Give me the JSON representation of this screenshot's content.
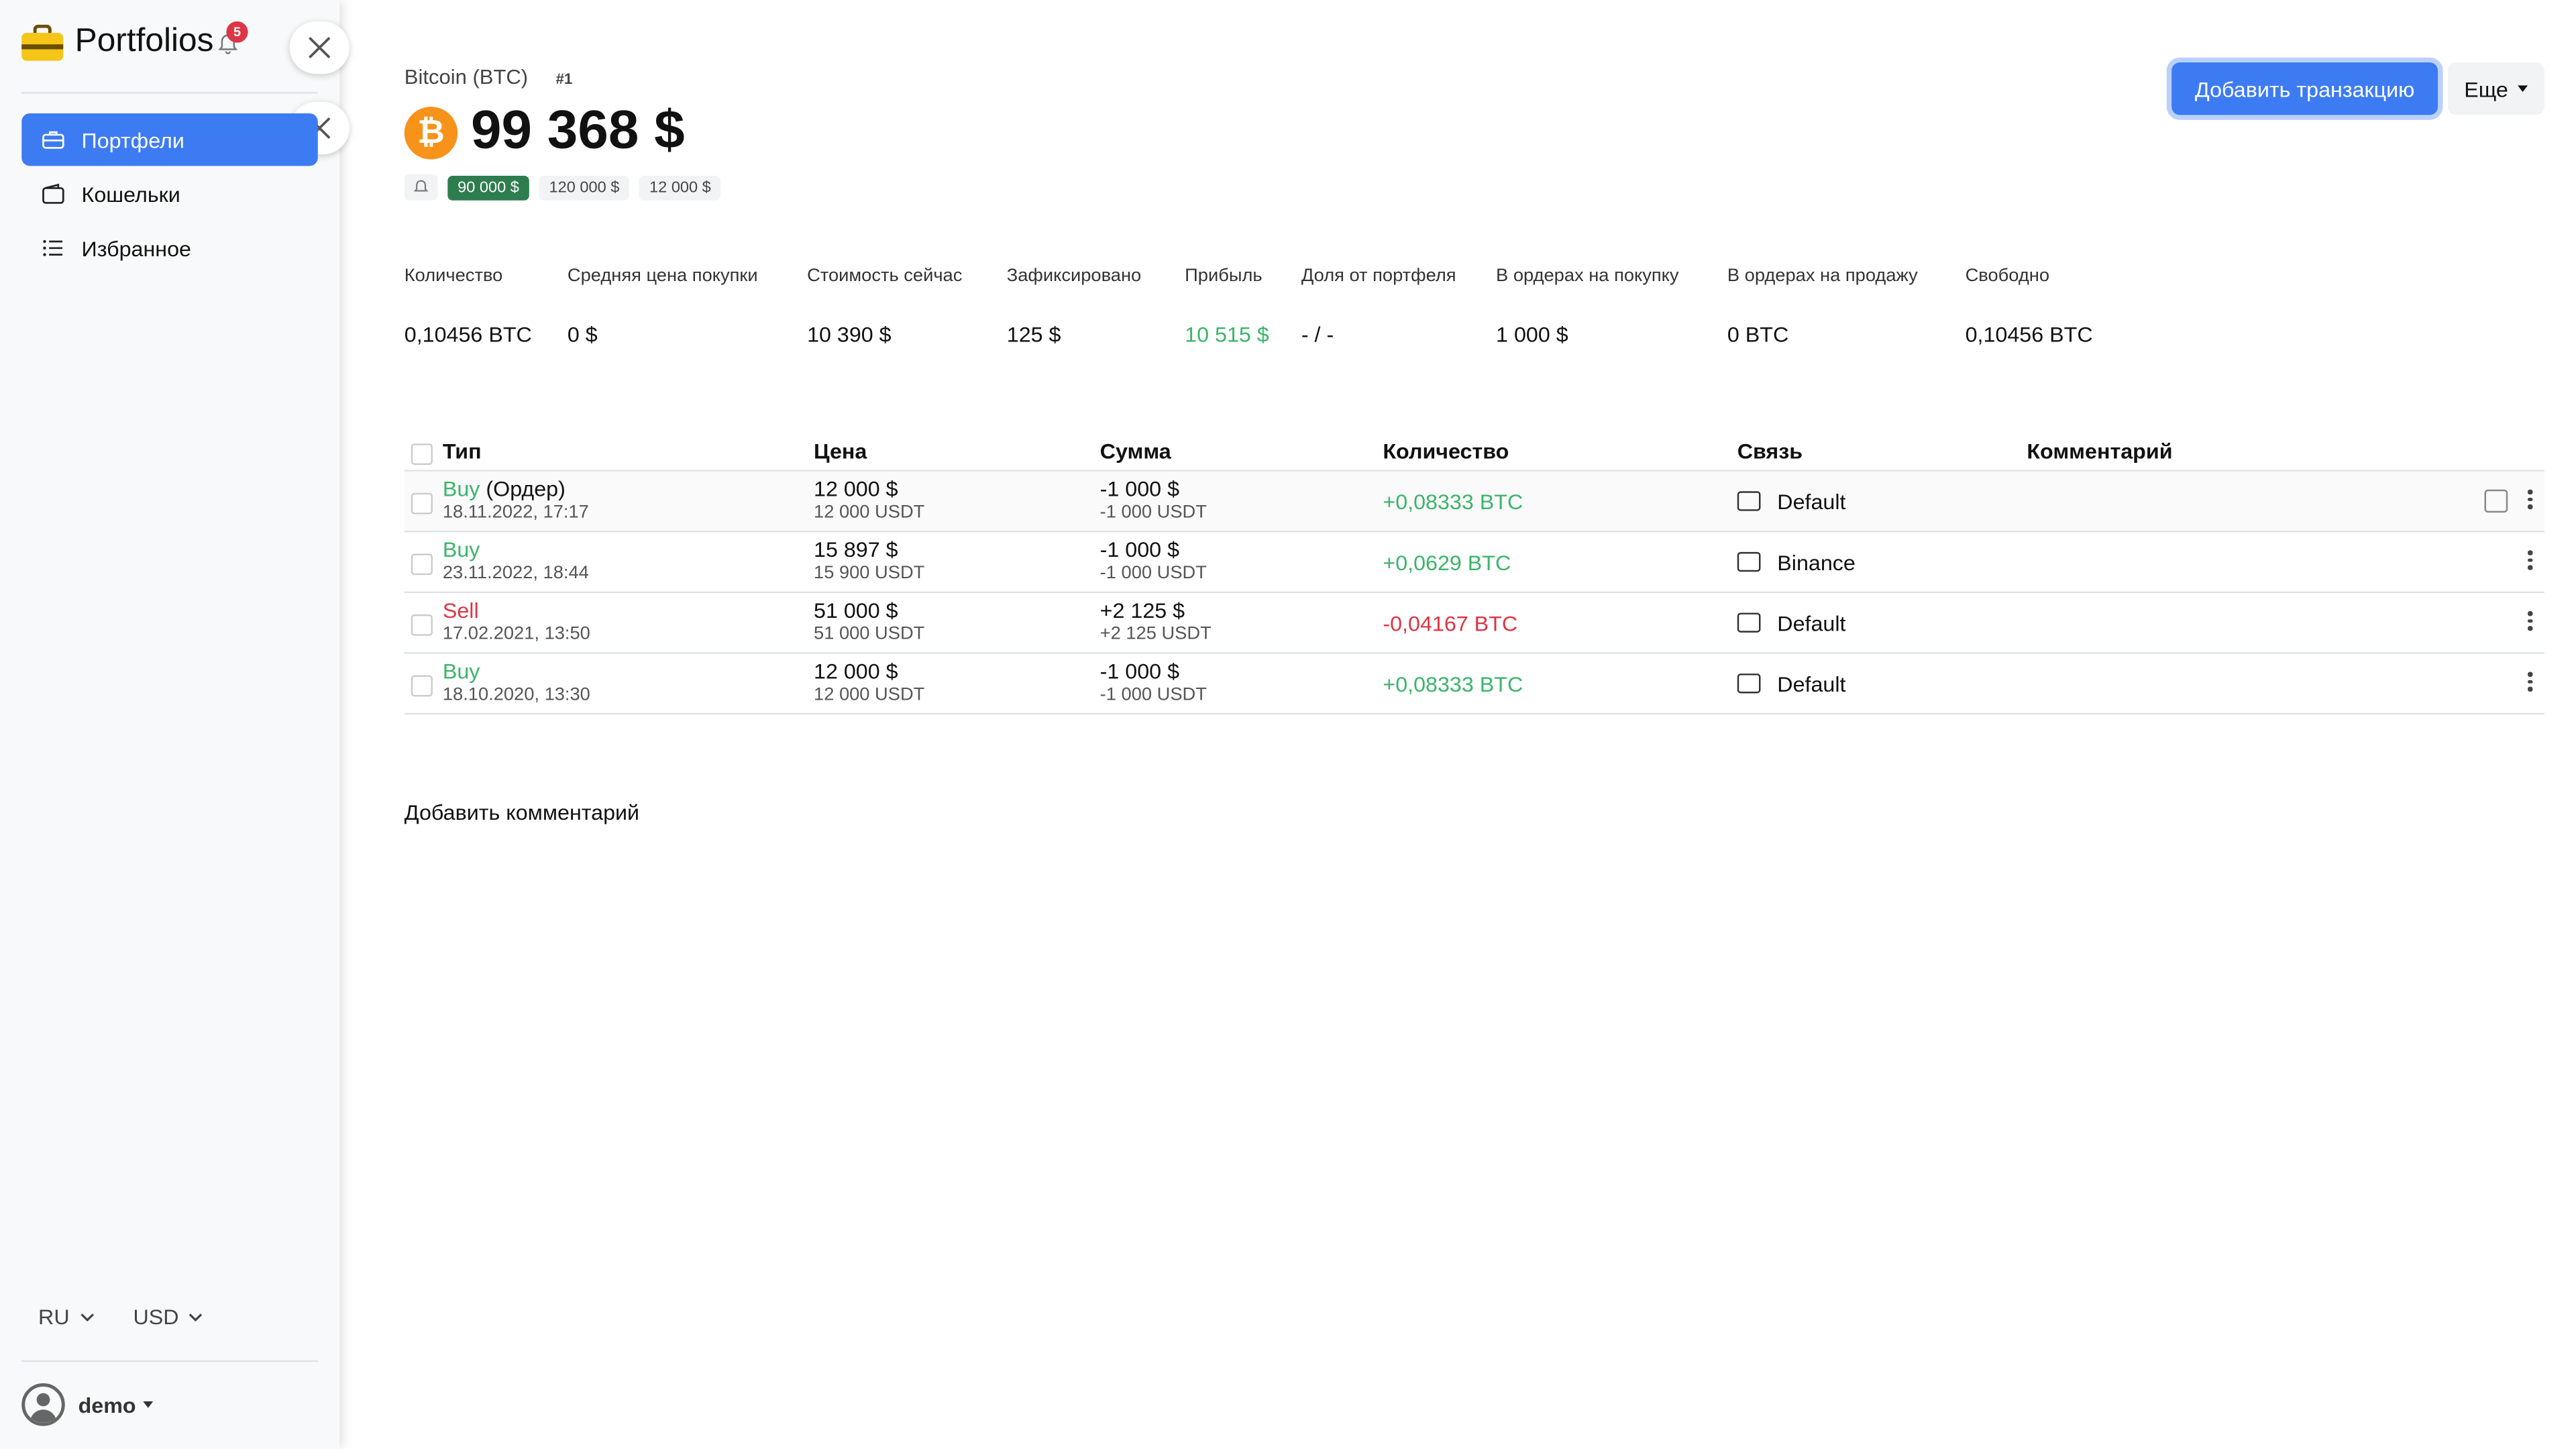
{
  "sidebar": {
    "brand": "Portfolios",
    "notifications_count": "5",
    "nav": [
      {
        "label": "Портфели",
        "icon": "briefcase-icon",
        "active": true
      },
      {
        "label": "Кошельки",
        "icon": "wallet-icon",
        "active": false
      },
      {
        "label": "Избранное",
        "icon": "list-icon",
        "active": false
      }
    ],
    "language": "RU",
    "currency": "USD",
    "user": "demo"
  },
  "header": {
    "asset_name": "Bitcoin (BTC)",
    "rank": "#1",
    "coin_symbol": "₿",
    "price": "99 368 $",
    "alerts": [
      "90 000 $",
      "120 000 $",
      "12 000 $"
    ],
    "add_button": "Добавить транзакцию",
    "more_button": "Еще"
  },
  "stats": [
    {
      "label": "Количество",
      "value": "0,10456 BTC"
    },
    {
      "label": "Средняя цена покупки",
      "value": "0 $"
    },
    {
      "label": "Стоимость сейчас",
      "value": "10 390 $"
    },
    {
      "label": "Зафиксировано",
      "value": "125 $"
    },
    {
      "label": "Прибыль",
      "value": "10 515 $"
    },
    {
      "label": "Доля от портфеля",
      "value": "- / -"
    },
    {
      "label": "В ордерах на покупку",
      "value": "1 000 $"
    },
    {
      "label": "В ордерах на продажу",
      "value": "0 BTC"
    },
    {
      "label": "Свободно",
      "value": "0,10456 BTC"
    }
  ],
  "table": {
    "headers": {
      "type": "Тип",
      "price": "Цена",
      "sum": "Сумма",
      "qty": "Количество",
      "link": "Связь",
      "comment": "Комментарий"
    },
    "rows": [
      {
        "type": "Buy",
        "type_extra": " (Ордер)",
        "date": "18.11.2022, 17:17",
        "price": "12 000 $",
        "price_sub": "12 000 USDT",
        "sum": "-1 000 $",
        "sum_sub": "-1 000 USDT",
        "qty": "+0,08333 BTC",
        "link": "Default"
      },
      {
        "type": "Buy",
        "type_extra": "",
        "date": "23.11.2022, 18:44",
        "price": "15 897 $",
        "price_sub": "15 900 USDT",
        "sum": "-1 000 $",
        "sum_sub": "-1 000 USDT",
        "qty": "+0,0629 BTC",
        "link": "Binance"
      },
      {
        "type": "Sell",
        "type_extra": "",
        "date": "17.02.2021, 13:50",
        "price": "51 000 $",
        "price_sub": "51 000 USDT",
        "sum": "+2 125 $",
        "sum_sub": "+2 125 USDT",
        "qty": "-0,04167 BTC",
        "link": "Default"
      },
      {
        "type": "Buy",
        "type_extra": "",
        "date": "18.10.2020, 13:30",
        "price": "12 000 $",
        "price_sub": "12 000 USDT",
        "sum": "-1 000 $",
        "sum_sub": "-1 000 USDT",
        "qty": "+0,08333 BTC",
        "link": "Default"
      }
    ]
  },
  "add_comment": "Добавить комментарий",
  "colors": {
    "accent": "#3d7bf2",
    "buy": "#3bb56a",
    "sell": "#dc3545",
    "alert_active": "#2e7d4f"
  }
}
